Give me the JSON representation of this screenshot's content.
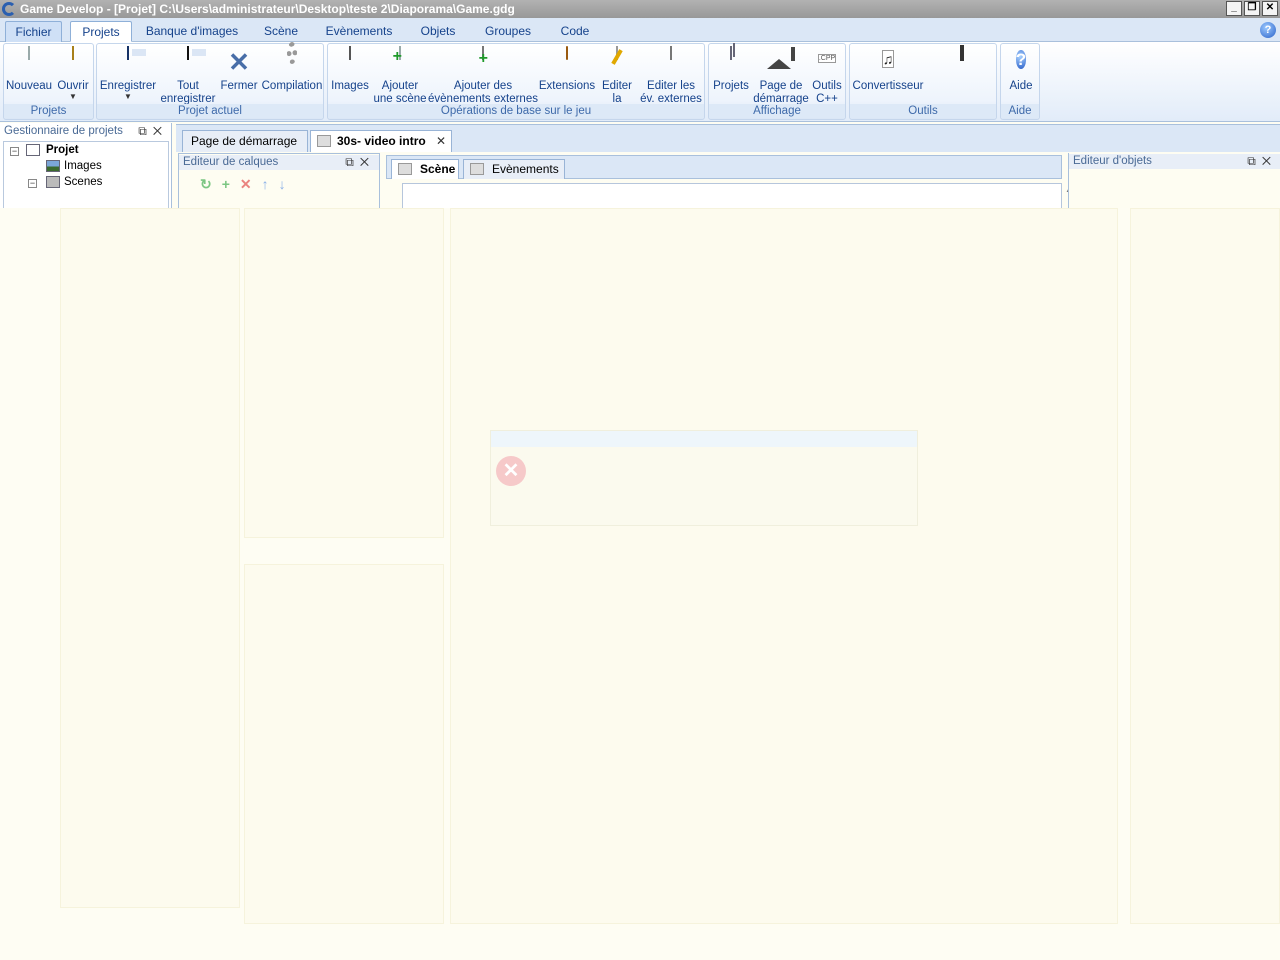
{
  "window": {
    "title": "Game Develop - [Projet] C:\\Users\\administrateur\\Desktop\\teste 2\\Diaporama\\Game.gdg"
  },
  "ribbon": {
    "tabs": [
      "Fichier",
      "Projets",
      "Banque d'images",
      "Scène",
      "Evènements",
      "Objets",
      "Groupes",
      "Code"
    ],
    "active_tab": "Projets",
    "groups": {
      "projets": {
        "label": "Projets",
        "buttons": {
          "nouveau": "Nouveau",
          "ouvrir": "Ouvrir"
        }
      },
      "projet_actuel": {
        "label": "Projet actuel",
        "buttons": {
          "enregistrer": "Enregistrer",
          "tout": "Tout",
          "tout2": "enregistrer",
          "fermer": "Fermer",
          "compilation": "Compilation"
        }
      },
      "operations": {
        "label": "Opérations de base sur le jeu",
        "buttons": {
          "images": "Images",
          "ajouter_scene_1": "Ajouter",
          "ajouter_scene_2": "une scène",
          "ajouter_ev_1": "Ajouter des",
          "ajouter_ev_2": "évènements externes",
          "extensions": "Extensions",
          "editer_1": "Editer",
          "editer_2": "la scène",
          "editer_ev_1": "Editer les",
          "editer_ev_2": "év. externes"
        }
      },
      "affichage": {
        "label": "Affichage",
        "buttons": {
          "projets": "Projets",
          "page_1": "Page de",
          "page_2": "démarrage",
          "outils_1": "Outils",
          "outils_2": "C++"
        }
      },
      "outils": {
        "label": "Outils",
        "buttons": {
          "convertisseur": "Convertisseur"
        }
      },
      "aide": {
        "label": "Aide",
        "buttons": {
          "aide": "Aide"
        }
      }
    }
  },
  "project_manager": {
    "title": "Gestionnaire de projets",
    "tree": {
      "root": "Projet",
      "images": "Images",
      "scenes": "Scenes"
    }
  },
  "document_tabs": {
    "start_page": "Page de démarrage",
    "scene": "30s- video intro"
  },
  "layer_editor": {
    "title": "Editeur de calques"
  },
  "scene_tabs": {
    "scene": "Scène",
    "events": "Evènements"
  },
  "object_editor": {
    "title": "Editeur d'objets"
  },
  "icons": {
    "app": "game-develop-logo-icon",
    "help": "help-icon",
    "error": "error-icon"
  },
  "colors": {
    "ribbon_bg": "#dbe7f6",
    "ribbon_text": "#15428b",
    "wash_overlay": "#fefdf3"
  }
}
